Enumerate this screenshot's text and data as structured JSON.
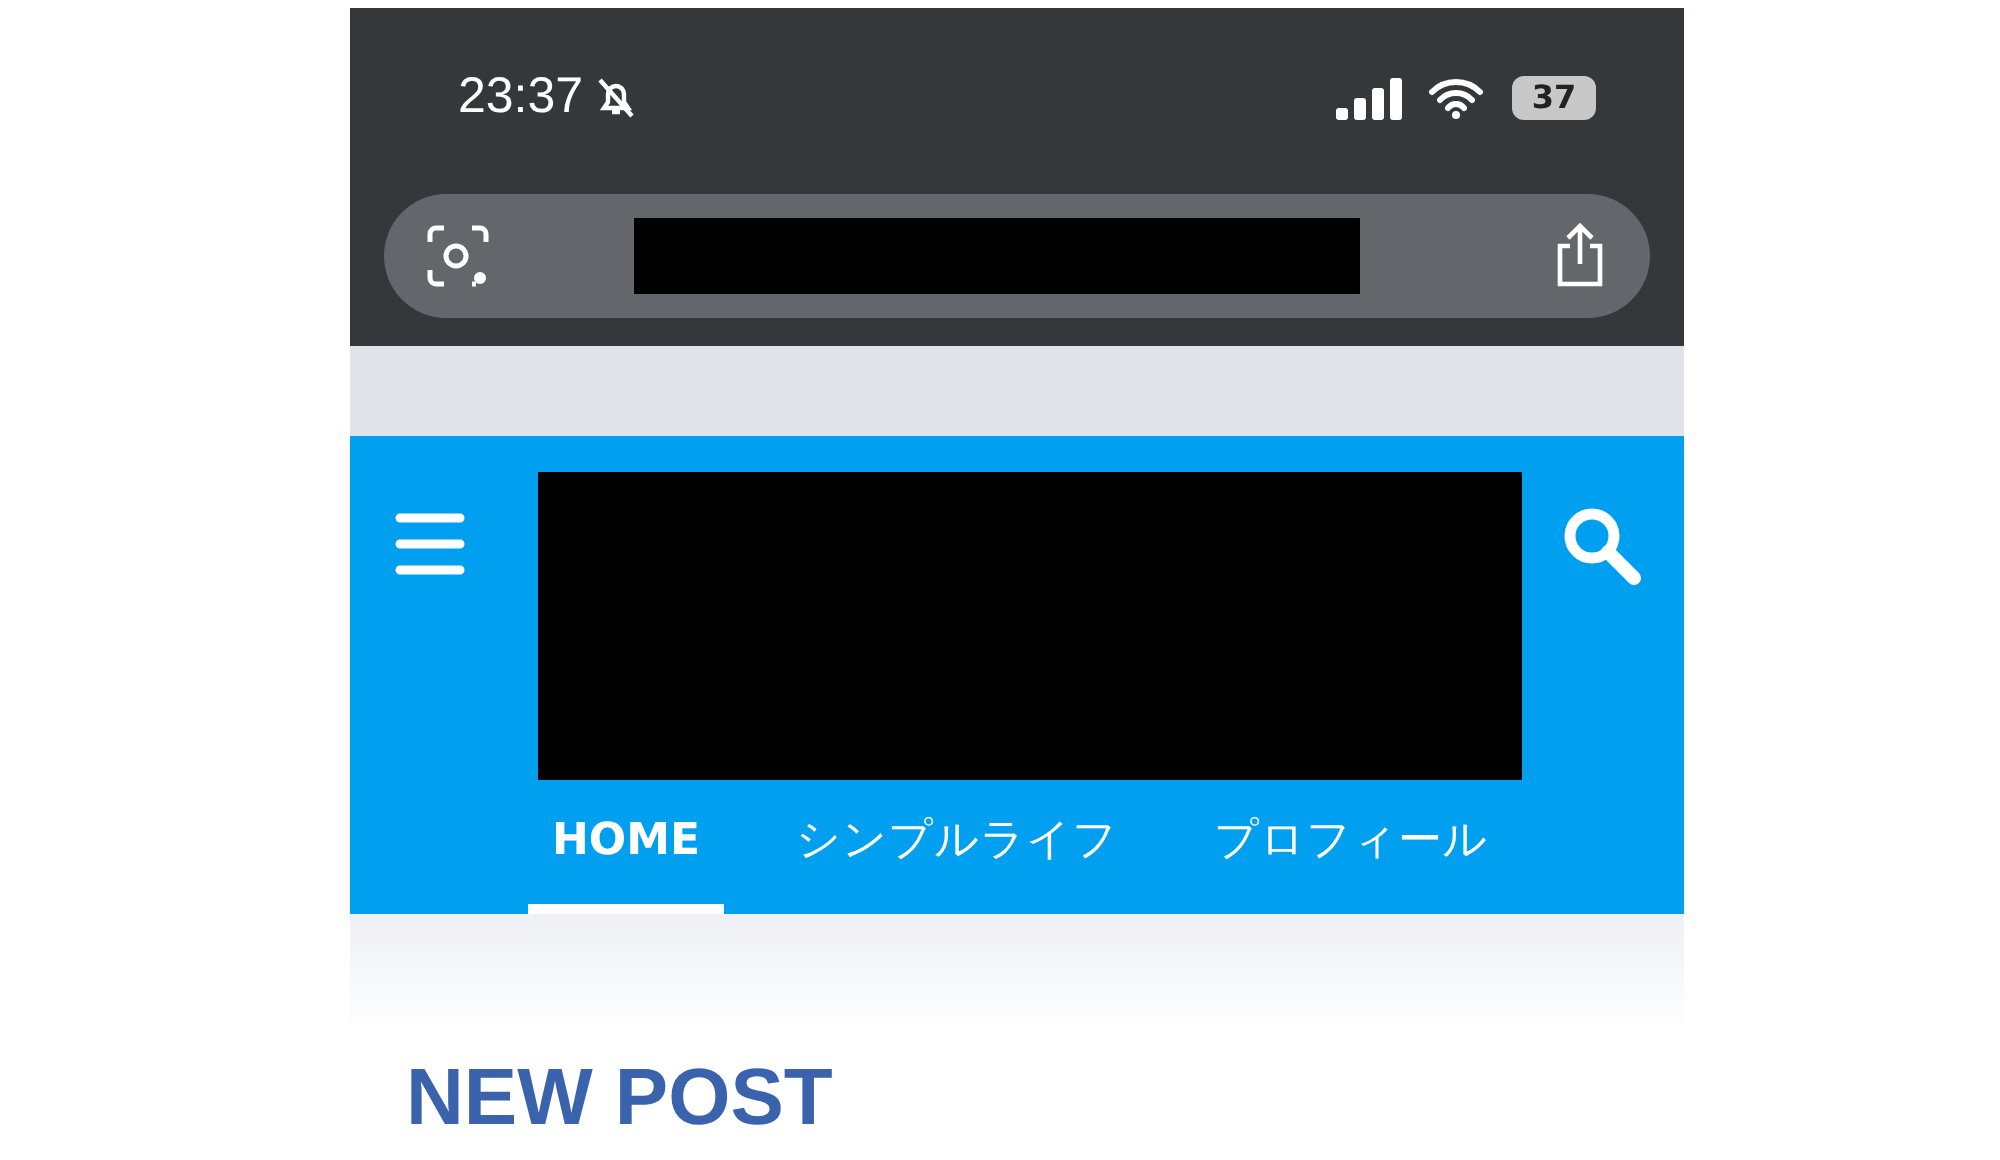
{
  "status_bar": {
    "time": "23:37",
    "battery": "37"
  },
  "browser": {
    "address_redacted": true
  },
  "site_header": {
    "logo_redacted": true
  },
  "nav": [
    {
      "label": "HOME",
      "selected": true
    },
    {
      "label": "シンプルライフ",
      "selected": false
    },
    {
      "label": "プロフィール",
      "selected": false
    }
  ],
  "section_heading": "NEW POST"
}
